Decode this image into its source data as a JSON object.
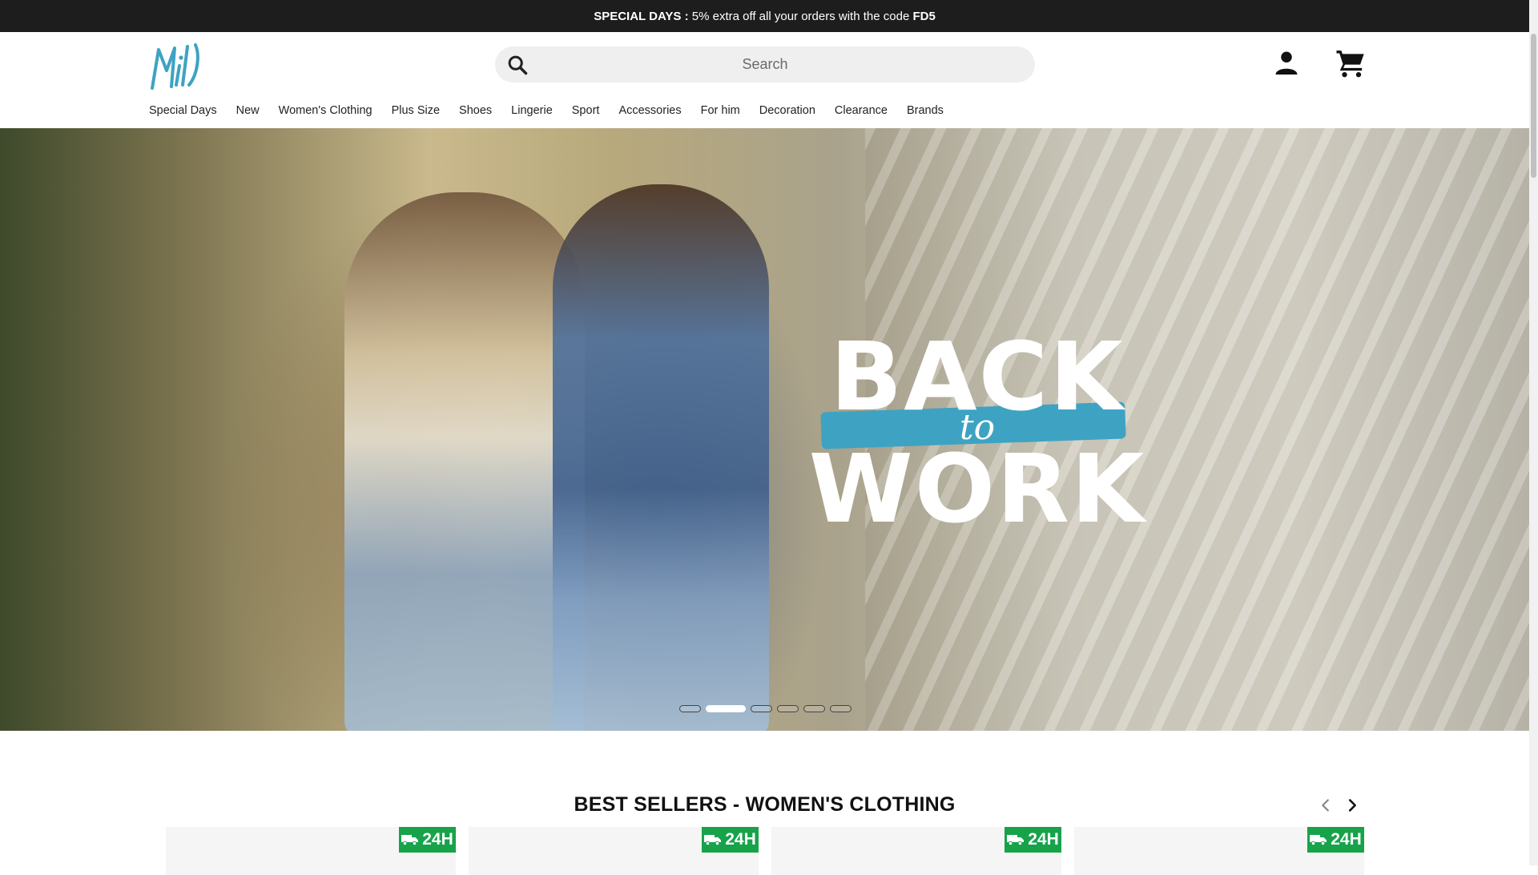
{
  "promo": {
    "label": "SPECIAL DAYS :",
    "text": "5% extra off all your orders with the code",
    "code": "FD5"
  },
  "header": {
    "logo_text": "Miit",
    "search": {
      "placeholder": "Search"
    }
  },
  "nav": {
    "items": [
      "Special Days",
      "New",
      "Women's Clothing",
      "Plus Size",
      "Shoes",
      "Lingerie",
      "Sport",
      "Accessories",
      "For him",
      "Decoration",
      "Clearance",
      "Brands"
    ]
  },
  "hero": {
    "title_line1": "BACK",
    "title_line2": "to",
    "title_line3": "WORK",
    "slides": 6,
    "active_slide": 2
  },
  "bestsellers": {
    "title": "BEST SELLERS - WOMEN'S CLOTHING",
    "cards": [
      {
        "badge": "24H"
      },
      {
        "badge": "24H"
      },
      {
        "badge": "24H"
      },
      {
        "badge": "24H"
      }
    ]
  },
  "colors": {
    "promo_bg": "#1d1d1d",
    "badge_green": "#16a34a",
    "logo_teal": "#3ea3c2",
    "brush_blue": "#3ea3c2"
  },
  "icons": [
    "search-icon",
    "user-icon",
    "cart-icon",
    "chevron-left-icon",
    "chevron-right-icon",
    "truck-icon"
  ]
}
